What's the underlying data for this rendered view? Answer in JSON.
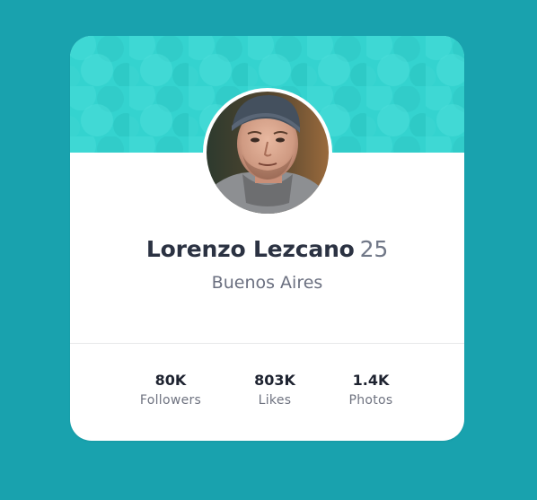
{
  "profile": {
    "name": "Lorenzo Lezcano",
    "age": "25",
    "location": "Buenos Aires"
  },
  "stats": [
    {
      "value": "80K",
      "label": "Followers"
    },
    {
      "value": "803K",
      "label": "Likes"
    },
    {
      "value": "1.4K",
      "label": "Photos"
    }
  ],
  "colors": {
    "page_background": "#19a2ae",
    "banner": "#34d3cf",
    "card": "#ffffff",
    "name_text": "#2b3242",
    "muted_text": "#6b7080"
  }
}
